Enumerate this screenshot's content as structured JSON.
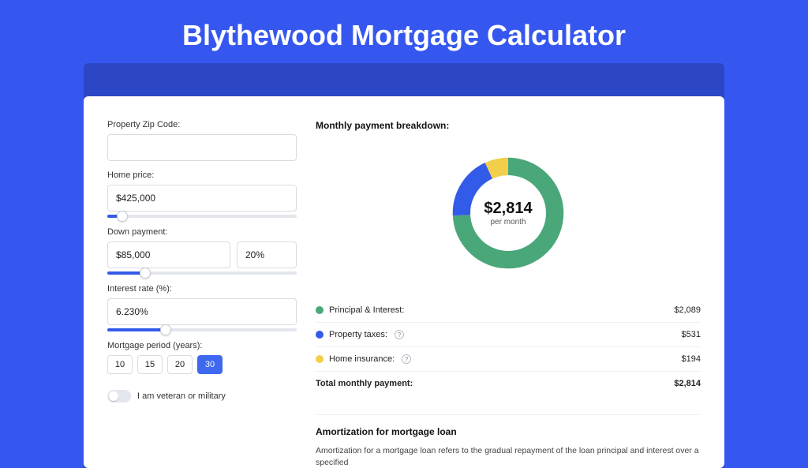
{
  "page": {
    "title": "Blythewood Mortgage Calculator"
  },
  "form": {
    "zip": {
      "label": "Property Zip Code:",
      "value": ""
    },
    "home_price": {
      "label": "Home price:",
      "value": "$425,000",
      "slider_pct": 8
    },
    "down_payment": {
      "label": "Down payment:",
      "value": "$85,000",
      "pct": "20%",
      "slider_pct": 20
    },
    "interest_rate": {
      "label": "Interest rate (%):",
      "value": "6.230%",
      "slider_pct": 31
    },
    "period": {
      "label": "Mortgage period (years):",
      "options": [
        "10",
        "15",
        "20",
        "30"
      ],
      "selected_index": 3
    },
    "veteran": {
      "label": "I am veteran or military",
      "checked": false
    }
  },
  "breakdown": {
    "title": "Monthly payment breakdown:",
    "center_value": "$2,814",
    "center_sub": "per month",
    "items": [
      {
        "label": "Principal & Interest:",
        "value": "$2,089",
        "color": "#4aa77a",
        "help": false
      },
      {
        "label": "Property taxes:",
        "value": "$531",
        "color": "#335be9",
        "help": true
      },
      {
        "label": "Home insurance:",
        "value": "$194",
        "color": "#f2cf4a",
        "help": true
      }
    ],
    "total": {
      "label": "Total monthly payment:",
      "value": "$2,814"
    }
  },
  "amort": {
    "title": "Amortization for mortgage loan",
    "text": "Amortization for a mortgage loan refers to the gradual repayment of the loan principal and interest over a specified"
  },
  "chart_data": {
    "type": "pie",
    "title": "Monthly payment breakdown",
    "categories": [
      "Principal & Interest",
      "Property taxes",
      "Home insurance"
    ],
    "values": [
      2089,
      531,
      194
    ],
    "colors": [
      "#4aa77a",
      "#335be9",
      "#f2cf4a"
    ],
    "total": 2814
  }
}
